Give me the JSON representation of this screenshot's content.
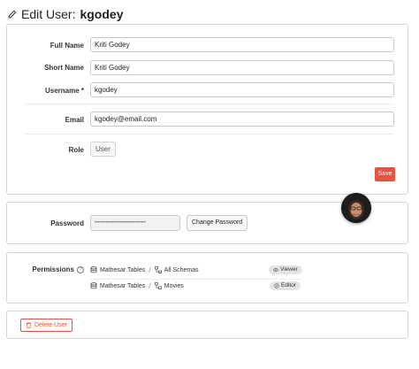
{
  "header": {
    "title_prefix": "Edit User:",
    "username": "kgodey"
  },
  "user_form": {
    "full_name": {
      "label": "Full Name",
      "value": "Kriti Godey"
    },
    "short_name": {
      "label": "Short Name",
      "value": "Kriti Godey"
    },
    "username": {
      "label": "Username *",
      "value": "kgodey"
    },
    "email": {
      "label": "Email",
      "value": "kgodey@email.com"
    },
    "role": {
      "label": "Role",
      "value": "User"
    },
    "save_label": "Save"
  },
  "password": {
    "label": "Password",
    "masked_value": "••••••••••••••••••••••••••••••••",
    "change_label": "Change Password"
  },
  "permissions": {
    "label": "Permissions",
    "help_glyph": "?",
    "rows": [
      {
        "database": "Mathesar Tables",
        "separator": "/",
        "schema": "All Schemas",
        "role": "Viewer"
      },
      {
        "database": "Mathesar Tables",
        "separator": "/",
        "schema": "Movies",
        "role": "Editor"
      }
    ]
  },
  "danger": {
    "delete_label": "Delete User"
  },
  "colors": {
    "accent_danger": "#e4543f",
    "border": "#d6d6d6",
    "badge_bg": "#e4e4e4"
  },
  "icons": {
    "title": "pencil-icon",
    "database": "database-icon",
    "schema": "schema-icon",
    "viewer_role": "viewer-icon",
    "editor_role": "editor-icon",
    "help": "help-icon",
    "delete": "trash-icon"
  }
}
